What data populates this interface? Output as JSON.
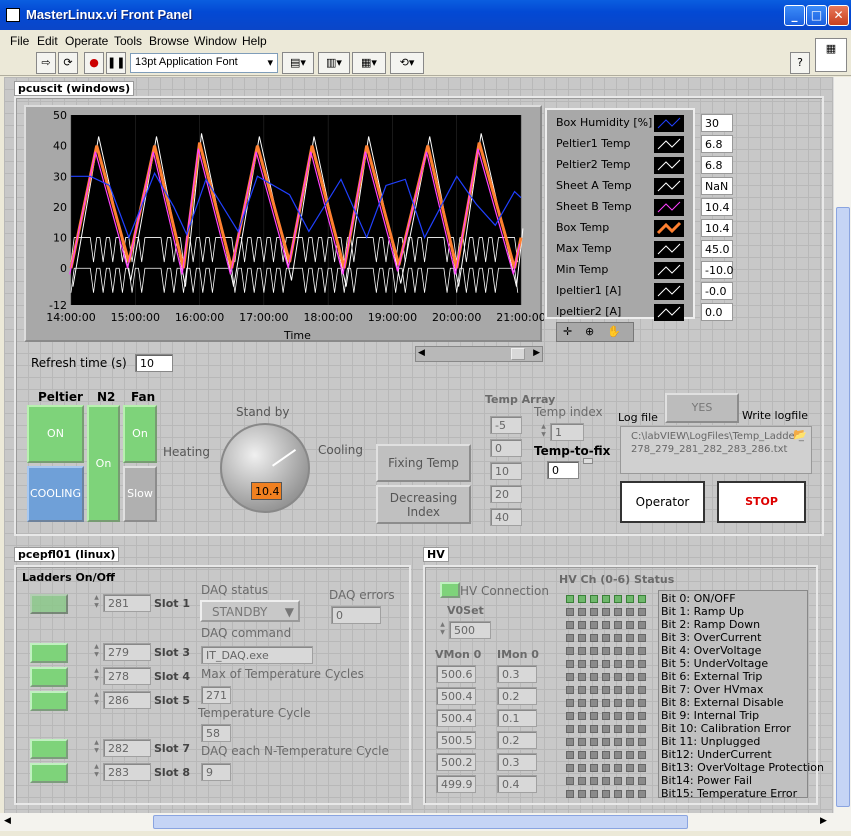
{
  "window": {
    "title": "MasterLinux.vi Front Panel",
    "minimize": "_",
    "maximize": "□",
    "close": "✕"
  },
  "menu": [
    "File",
    "Edit",
    "Operate",
    "Tools",
    "Browse",
    "Window",
    "Help"
  ],
  "toolbar": {
    "font": "13pt Application Font",
    "help": "?"
  },
  "pcuscit": {
    "title": "pcuscit (windows)",
    "refresh_label": "Refresh time (s)",
    "refresh_value": "10",
    "peltier_label": "Peltier",
    "n2_label": "N2",
    "fan_label": "Fan",
    "peltier_on": "ON",
    "peltier_mode": "COOLING",
    "n2_state": "On",
    "fan_on": "On",
    "fan_speed": "Slow",
    "knob": {
      "standby": "Stand by",
      "heating": "Heating",
      "cooling": "Cooling",
      "value": "10.4"
    },
    "fixing_temp": "Fixing Temp",
    "decreasing_index": "Decreasing Index",
    "temp_array_label": "Temp Array",
    "temp_array": [
      "-5",
      "0",
      "10",
      "20",
      "40"
    ],
    "temp_index_label": "Temp index",
    "temp_index": "1",
    "temp_to_fix_label": "Temp-to-fix",
    "temp_to_fix": "0",
    "log_file_label": "Log file",
    "yes_label": "YES",
    "write_logfile": "Write logfile",
    "log_path": "C:\\labVIEW\\LogFiles\\Temp_Ladder_278_279_281_282_283_286.txt",
    "operator_btn": "Operator",
    "stop_btn": "STOP"
  },
  "chart_data": {
    "type": "line",
    "xlabel": "Time",
    "x_ticks": [
      "14:00:00",
      "15:00:00",
      "16:00:00",
      "17:00:00",
      "18:00:00",
      "19:00:00",
      "20:00:00",
      "21:00:00"
    ],
    "y_ticks": [
      "50",
      "40",
      "30",
      "20",
      "10",
      "0",
      "-12"
    ],
    "ylim": [
      -12,
      50
    ],
    "legend": [
      {
        "name": "Box Humidity [%]",
        "value": "30",
        "color": "#2040ff"
      },
      {
        "name": "Peltier1 Temp",
        "value": "6.8",
        "color": "#ffffff"
      },
      {
        "name": "Peltier2 Temp",
        "value": "6.8",
        "color": "#ffffff"
      },
      {
        "name": "Sheet A Temp",
        "value": "NaN",
        "color": "#ffffff"
      },
      {
        "name": "Sheet B Temp",
        "value": "10.4",
        "color": "#ff40ff"
      },
      {
        "name": "Box Temp",
        "value": "10.4",
        "color": "#ff8030"
      },
      {
        "name": "Max Temp",
        "value": "45.0",
        "color": "#ffffff"
      },
      {
        "name": "Min Temp",
        "value": "-10.0",
        "color": "#ffffff"
      },
      {
        "name": "Ipeltier1 [A]",
        "value": "-0.0",
        "color": "#ffffff"
      },
      {
        "name": "Ipeltier2 [A]",
        "value": "0.0",
        "color": "#ffffff"
      }
    ],
    "series": [
      {
        "name": "Box Temp",
        "color": "#ff8030",
        "points": [
          [
            14.0,
            0
          ],
          [
            14.4,
            40
          ],
          [
            14.9,
            2
          ],
          [
            15.3,
            40
          ],
          [
            15.75,
            0
          ],
          [
            16.0,
            41
          ],
          [
            16.5,
            0
          ],
          [
            16.9,
            40
          ],
          [
            17.4,
            2
          ],
          [
            17.75,
            40
          ],
          [
            18.25,
            0
          ],
          [
            18.6,
            40
          ],
          [
            19.1,
            1
          ],
          [
            19.55,
            40
          ],
          [
            20.0,
            0
          ],
          [
            20.35,
            41
          ],
          [
            20.9,
            0
          ],
          [
            21.0,
            10
          ]
        ]
      },
      {
        "name": "Box Humidity [%]",
        "color": "#2040ff",
        "points": [
          [
            14.0,
            30
          ],
          [
            14.3,
            30
          ],
          [
            14.6,
            27
          ],
          [
            14.9,
            10
          ],
          [
            15.3,
            31
          ],
          [
            15.6,
            20
          ],
          [
            15.8,
            11
          ],
          [
            16.1,
            29
          ],
          [
            16.6,
            12
          ],
          [
            16.9,
            30
          ],
          [
            17.4,
            24
          ],
          [
            17.7,
            12
          ],
          [
            18.2,
            29
          ],
          [
            18.6,
            10
          ],
          [
            18.9,
            27
          ],
          [
            19.2,
            29
          ],
          [
            19.5,
            10
          ],
          [
            20.0,
            30
          ],
          [
            20.3,
            21
          ],
          [
            20.6,
            14
          ],
          [
            20.9,
            25
          ],
          [
            21.0,
            23
          ]
        ]
      }
    ]
  },
  "pcepfl01": {
    "title": "pcepfl01 (linux)",
    "ladders_label": "Ladders On/Off",
    "slots": [
      {
        "id": "281",
        "label": "Slot 1"
      },
      {
        "id": "279",
        "label": "Slot 3"
      },
      {
        "id": "278",
        "label": "Slot 4"
      },
      {
        "id": "286",
        "label": "Slot 5"
      },
      {
        "id": "282",
        "label": "Slot 7"
      },
      {
        "id": "283",
        "label": "Slot 8"
      }
    ],
    "daq_status_label": "DAQ status",
    "daq_status": "STANDBY",
    "daq_errors_label": "DAQ errors",
    "daq_errors": "0",
    "daq_command_label": "DAQ command",
    "daq_command": "IT_DAQ.exe",
    "max_cycles_label": "Max of Temperature Cycles",
    "max_cycles": "271",
    "temp_cycle_label": "Temperature Cycle",
    "temp_cycle": "58",
    "daq_each_label": "DAQ each N-Temperature Cycle",
    "daq_each": "9"
  },
  "hv": {
    "title": "HV",
    "connection_label": "HV Connection",
    "v0set_label": "V0Set",
    "v0set": "500",
    "vmon_label": "VMon 0",
    "imon_label": "IMon 0",
    "vmon": [
      "500.6",
      "500.4",
      "500.4",
      "500.5",
      "500.2",
      "499.9"
    ],
    "imon": [
      "0.3",
      "0.2",
      "0.1",
      "0.2",
      "0.3",
      "0.4"
    ],
    "status_label": "HV Ch (0-6) Status",
    "bits": [
      "Bit 0: ON/OFF",
      "Bit 1: Ramp Up",
      "Bit 2: Ramp Down",
      "Bit 3: OverCurrent",
      "Bit 4: OverVoltage",
      "Bit 5: UnderVoltage",
      "Bit 6: External Trip",
      "Bit 7: Over HVmax",
      "Bit 8: External Disable",
      "Bit 9: Internal Trip",
      "Bit 10: Calibration Error",
      "Bit 11: Unplugged",
      "Bit12: UnderCurrent",
      "Bit13: OverVoltage Protection",
      "Bit14: Power Fail",
      "Bit15: Temperature Error"
    ]
  }
}
